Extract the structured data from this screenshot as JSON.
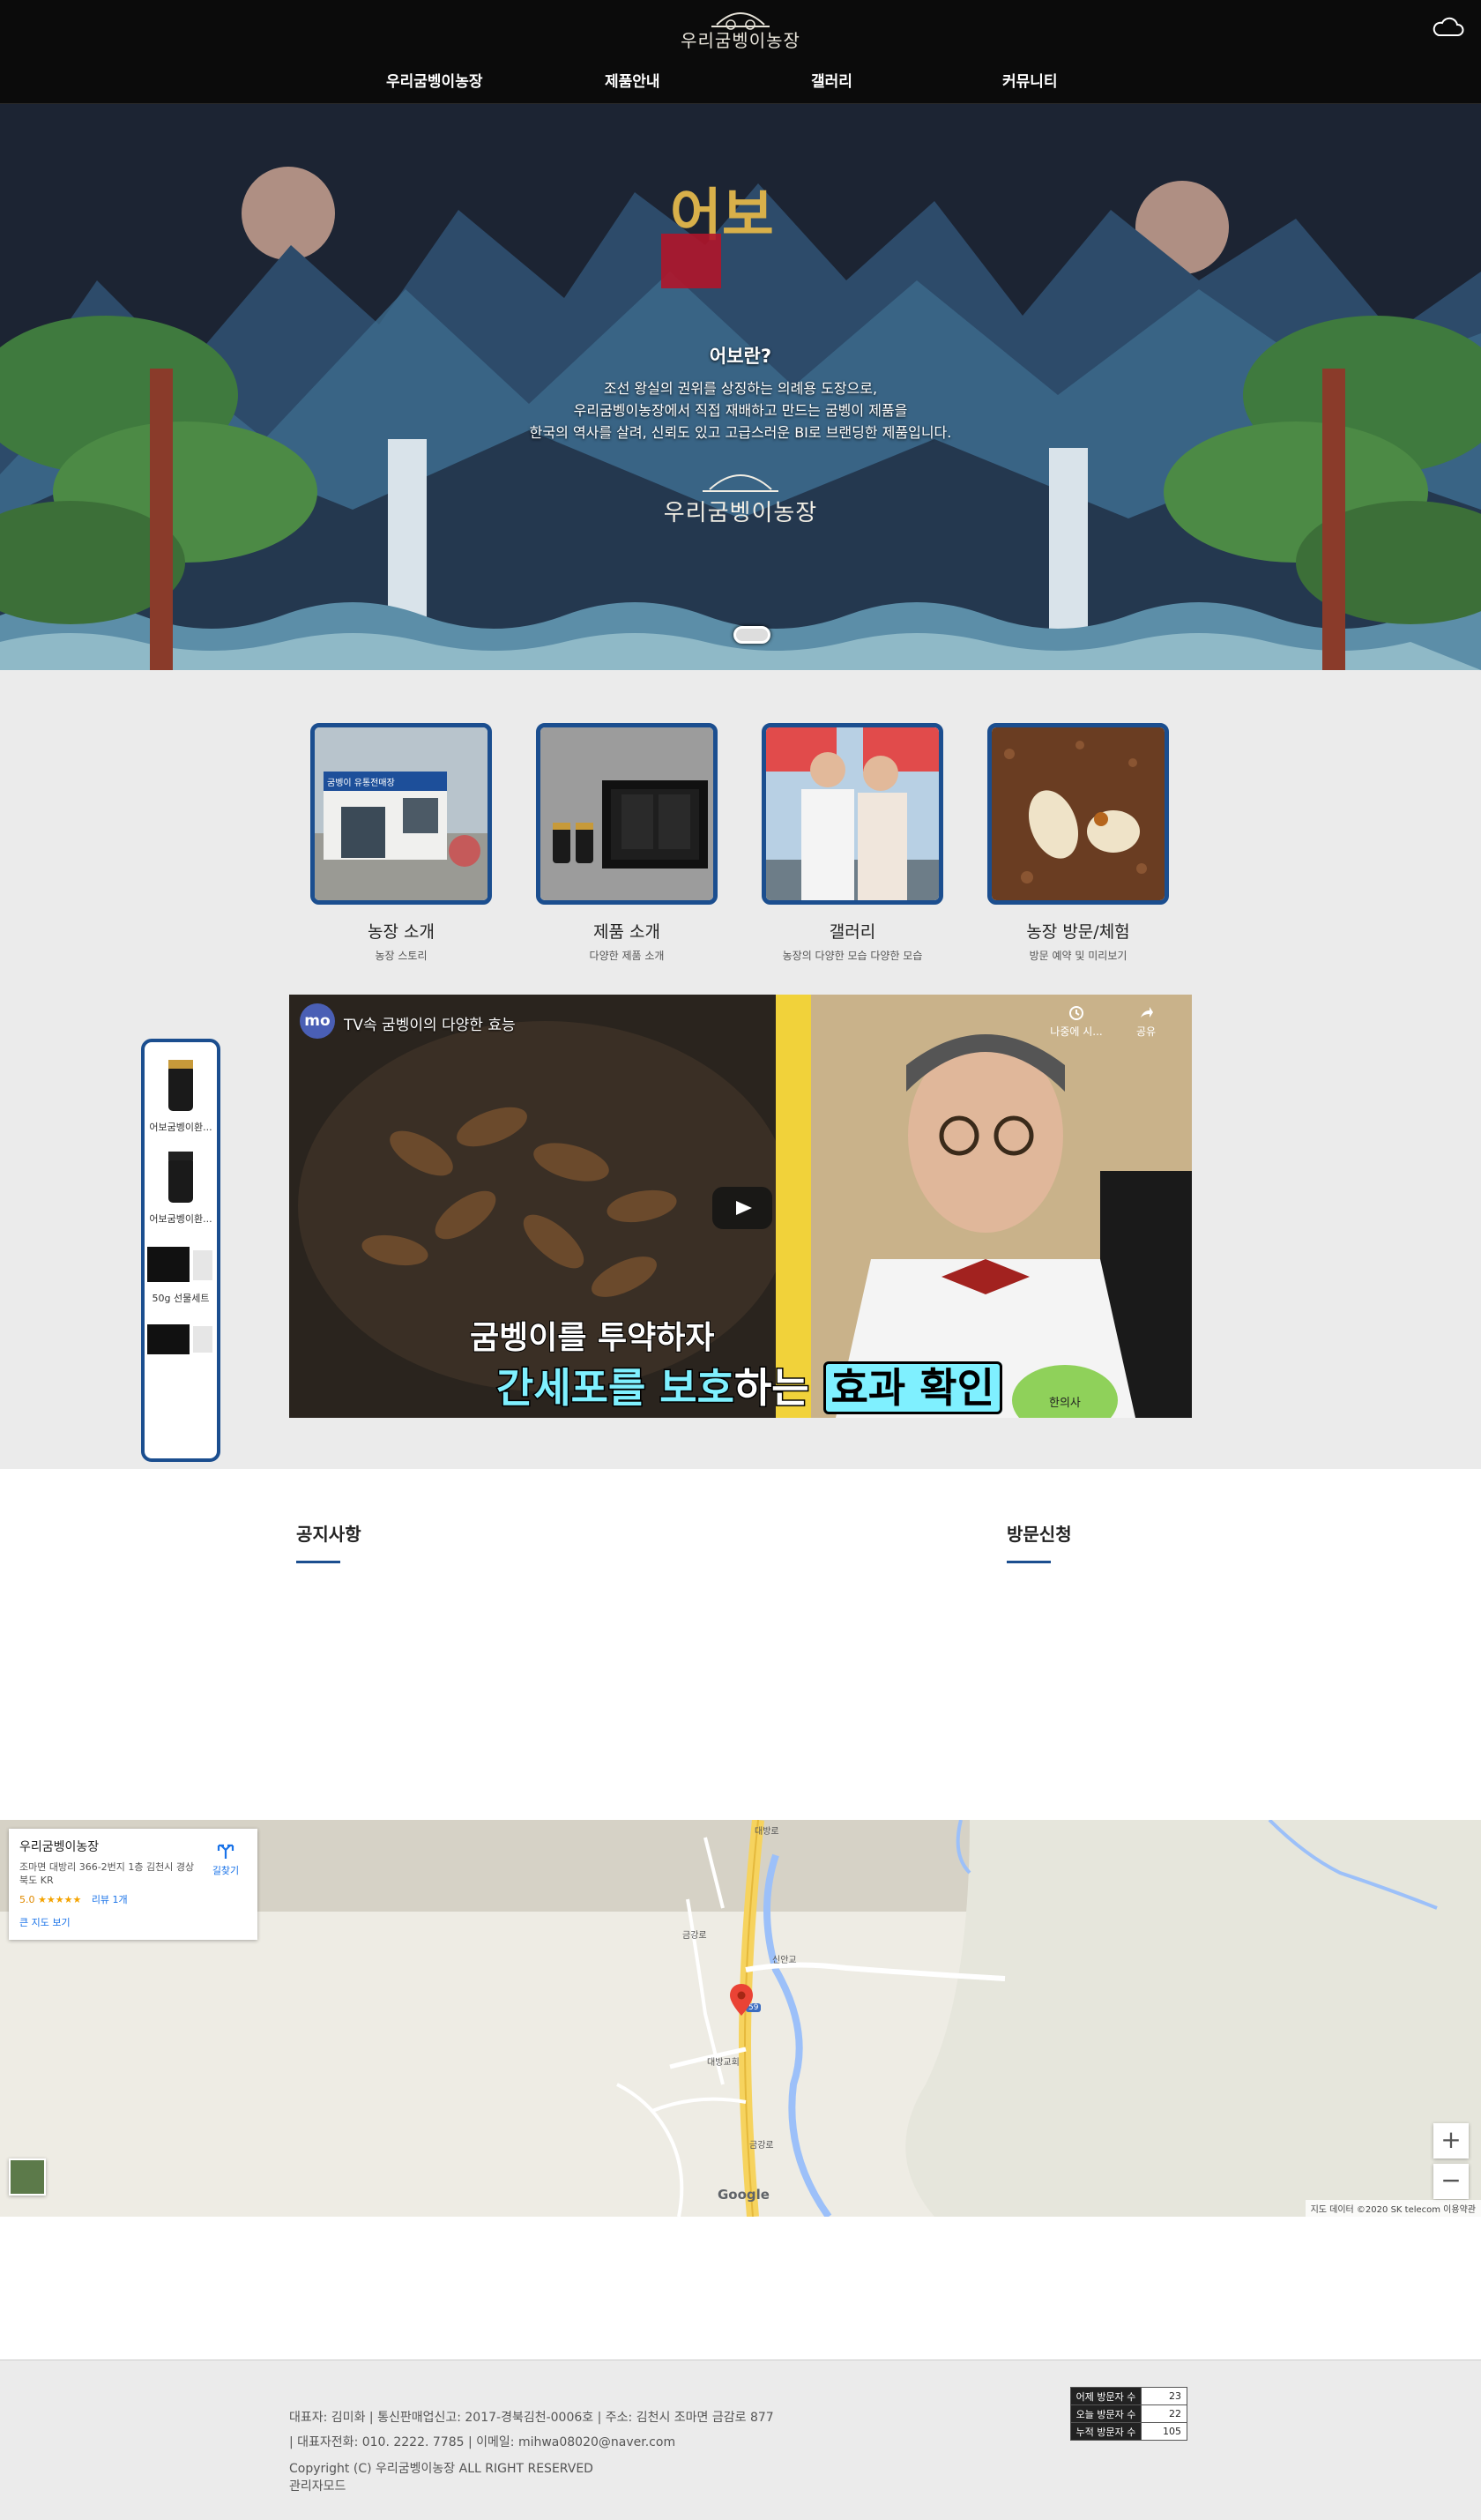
{
  "header": {
    "logo_text": "우리굼벵이농장",
    "nav": [
      "우리굼벵이농장",
      "제품안내",
      "갤러리",
      "커뮤니티"
    ]
  },
  "hero": {
    "brand": "어보",
    "question": "어보란?",
    "lines": [
      "조선 왕실의 권위를 상징하는 의례용 도장으로,",
      "우리굼벵이농장에서 직접 재배하고 만드는 굼벵이 제품을",
      "한국의 역사를 살려, 신뢰도 있고 고급스러운 BI로 브랜딩한 제품입니다."
    ],
    "logo_text": "우리굼벵이농장",
    "storefront_sign": "굼벵이 유통전매장"
  },
  "cards": [
    {
      "title": "농장 소개",
      "sub": "농장 스토리"
    },
    {
      "title": "제품 소개",
      "sub": "다양한 제품 소개"
    },
    {
      "title": "갤러리",
      "sub": "농장의 다양한 모습 다양한 모습"
    },
    {
      "title": "농장 방문/체험",
      "sub": "방문 예약 및 미리보기"
    }
  ],
  "video": {
    "channel": "mo",
    "title": "TV속 굼벵이의 다양한 효능",
    "later": "나중에 시...",
    "share": "공유",
    "caption1": "굼벵이를 투약하자",
    "caption2_a": "간세포를 보호",
    "caption2_b": "하는",
    "caption2_c": "효과 확인",
    "tv_tag": "한의사"
  },
  "quick": [
    {
      "label": "어보굼벵이환..."
    },
    {
      "label": "어보굼벵이환..."
    },
    {
      "label": "50g 선물세트"
    },
    {
      "label": ""
    }
  ],
  "sections": {
    "notice": "공지사항",
    "visit": "방문신청"
  },
  "map": {
    "place": "우리굼벵이농장",
    "address": "조마면 대방리 366-2번지 1층 김천시 경상북도 KR",
    "rating": "5.0",
    "stars": "★★★★★",
    "reviews": "리뷰 1개",
    "big_map": "큰 지도 보기",
    "directions": "길찾기",
    "labels": {
      "road_n": "대방로",
      "bridge": "신안교",
      "road_w": "금강로",
      "church": "대방교회",
      "road_s": "금강로",
      "route": "59"
    },
    "attribution": "지도 데이터 ©2020 SK telecom    이용약관",
    "google": "Google",
    "zoom_in": "+",
    "zoom_out": "−"
  },
  "footer": {
    "line1": "대표자: 김미화 | 통신판매업신고: 2017-경북김천-0006호 | 주소: 김천시 조마면 금감로 877",
    "line2": "| 대표자전화: 010. 2222. 7785 | 이메일: mihwa08020@naver.com",
    "line3": "Copyright (C) 우리굼벵이농장 ALL RIGHT RESERVED",
    "admin": "관리자모드",
    "visitors": [
      {
        "label": "어제 방문자 수",
        "value": "23"
      },
      {
        "label": "오늘 방문자 수",
        "value": "22"
      },
      {
        "label": "누적 방문자 수",
        "value": "105"
      }
    ]
  },
  "colors": {
    "accent": "#1b4e8f",
    "header_bg": "#0b0b0b",
    "gold": "#d8b04a"
  }
}
